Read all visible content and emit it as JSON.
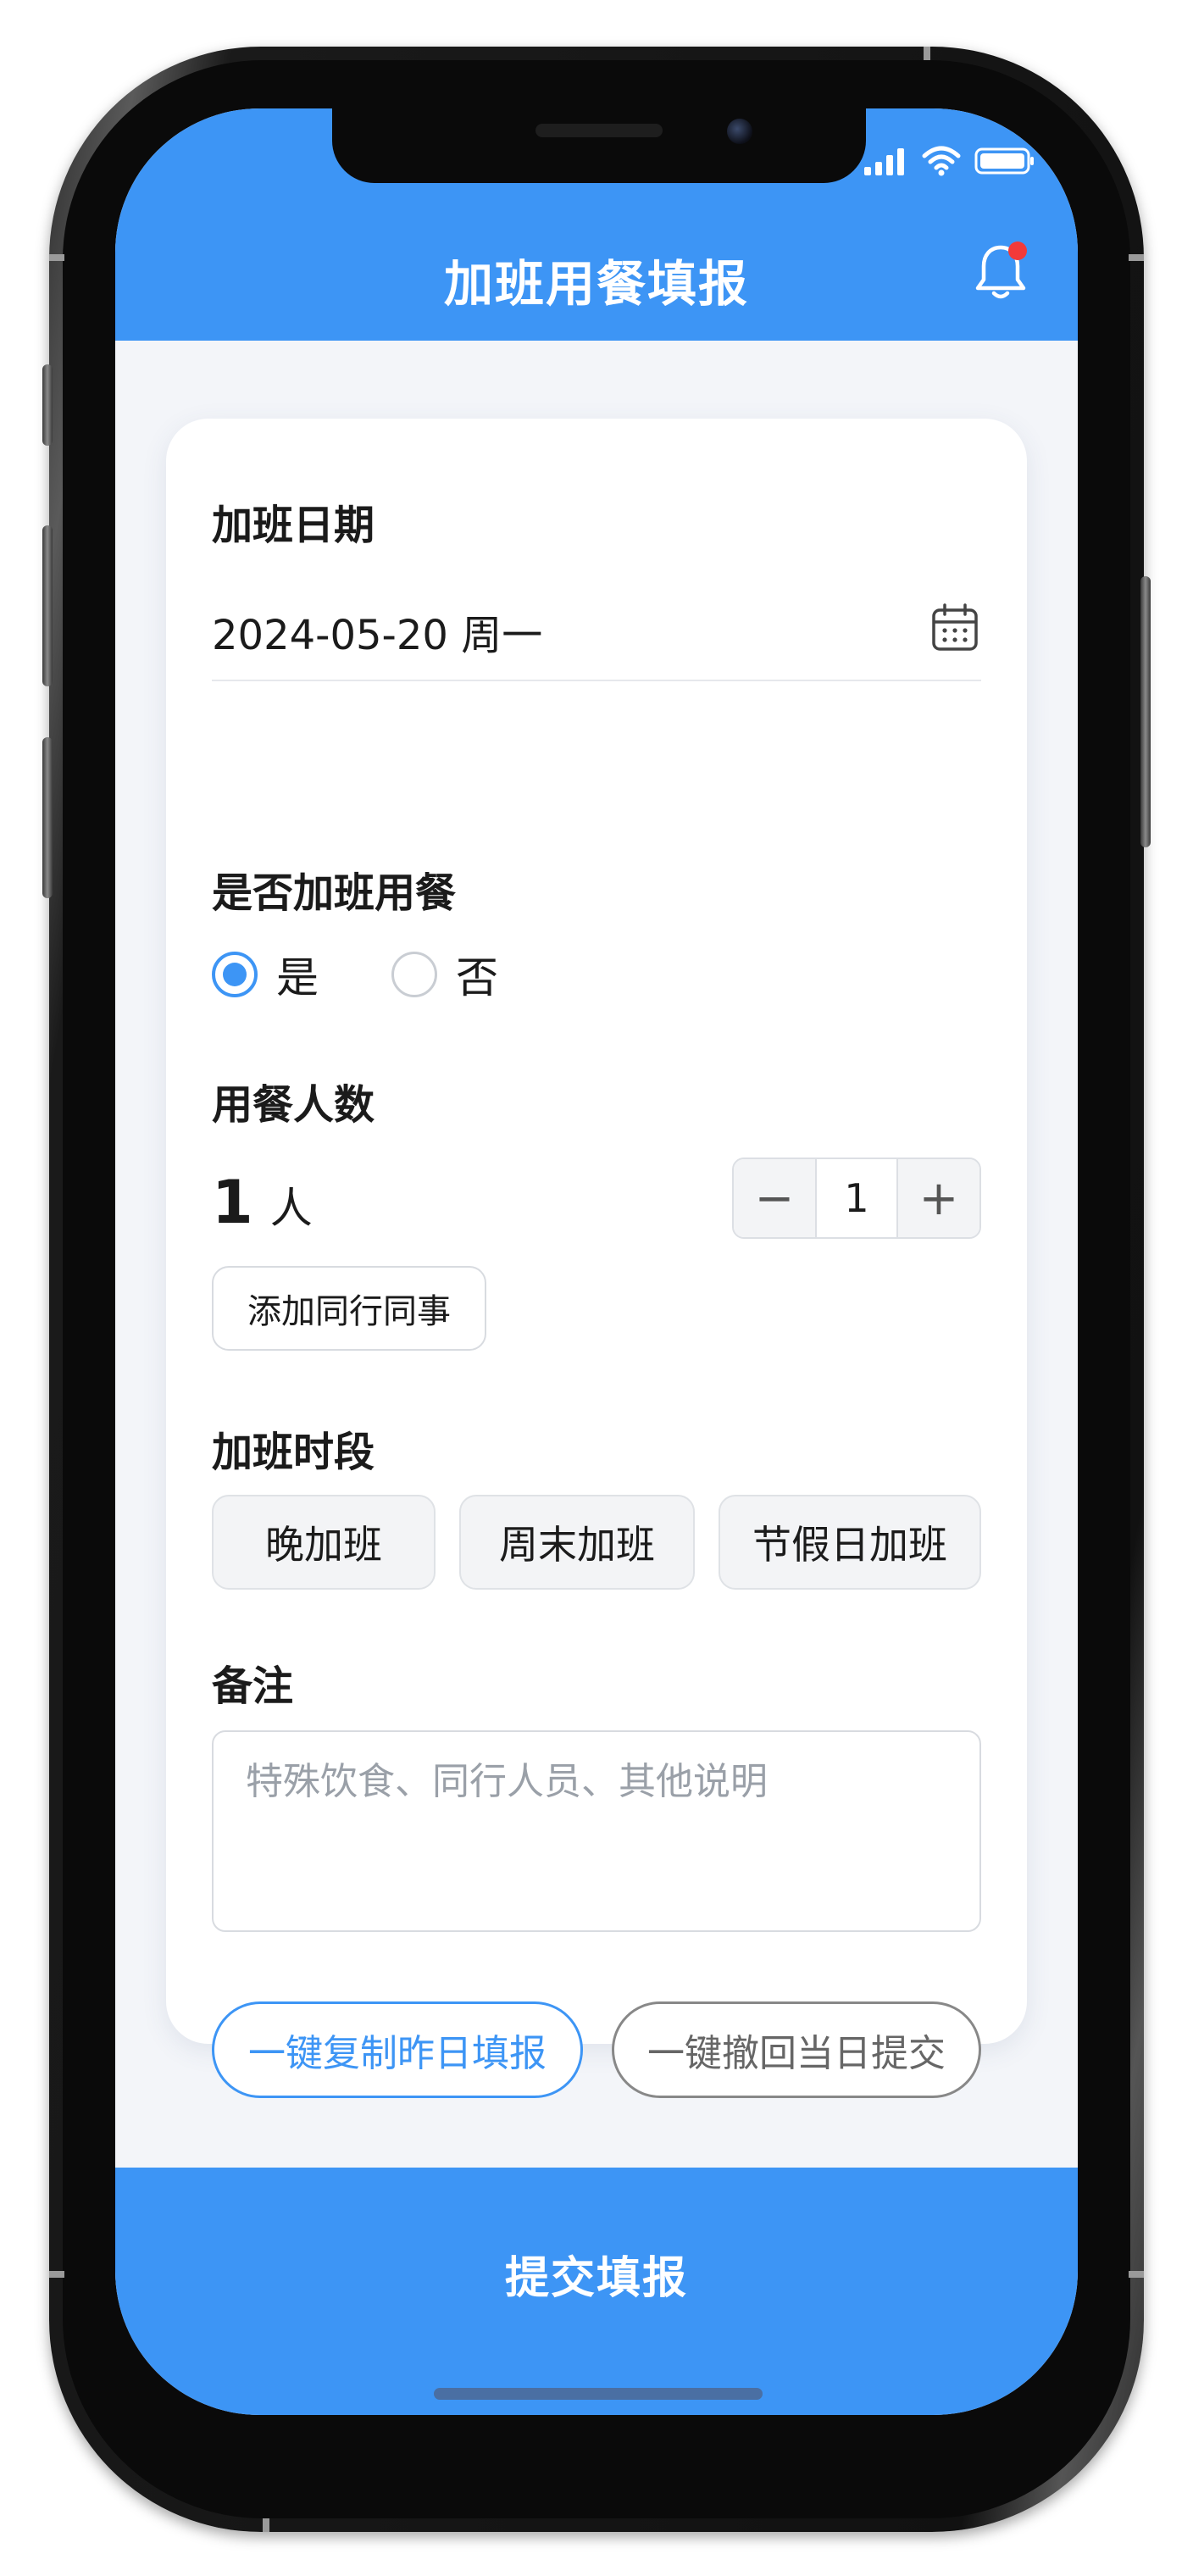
{
  "header": {
    "title": "加班用餐填报"
  },
  "form": {
    "date_label": "加班日期",
    "date_value": "2024-05-20 周一",
    "meal_label": "是否加班用餐",
    "meal_options": [
      {
        "label": "是",
        "selected": true
      },
      {
        "label": "否",
        "selected": false
      }
    ],
    "people_label": "用餐人数",
    "people_count": "1",
    "people_unit": "人",
    "stepper": {
      "minus": "−",
      "value": "1",
      "plus": "+"
    },
    "add_colleague": "添加同行同事",
    "period_label": "加班时段",
    "periods": [
      "晚加班",
      "周末加班",
      "节假日加班"
    ],
    "remark_label": "备注",
    "remark_placeholder": "特殊饮食、同行人员、其他说明",
    "copy_button": "一键复制昨日填报",
    "revoke_button": "一键撤回当日提交"
  },
  "submit": {
    "label": "提交填报"
  },
  "colors": {
    "accent": "#3d95f5",
    "notification_dot": "#f23a3a",
    "background": "#f3f5f9"
  },
  "icons": [
    "bell-icon",
    "calendar-icon",
    "signal-icon",
    "wifi-icon",
    "battery-icon"
  ]
}
